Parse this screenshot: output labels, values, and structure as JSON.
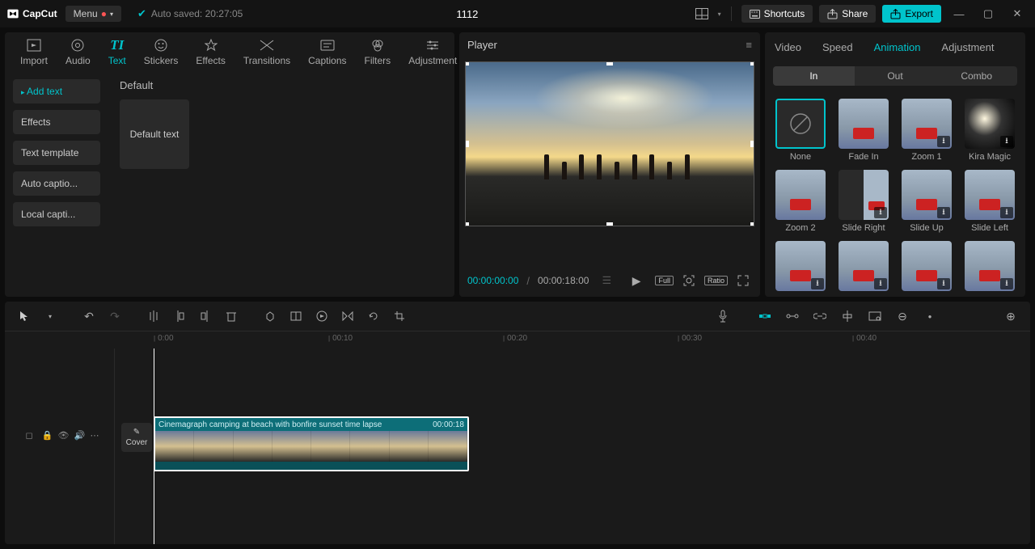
{
  "titlebar": {
    "app_name": "CapCut",
    "menu_label": "Menu",
    "auto_saved": "Auto saved: 20:27:05",
    "project_title": "1112",
    "shortcuts_label": "Shortcuts",
    "share_label": "Share",
    "export_label": "Export"
  },
  "media_tabs": [
    {
      "label": "Import"
    },
    {
      "label": "Audio"
    },
    {
      "label": "Text"
    },
    {
      "label": "Stickers"
    },
    {
      "label": "Effects"
    },
    {
      "label": "Transitions"
    },
    {
      "label": "Captions"
    },
    {
      "label": "Filters"
    },
    {
      "label": "Adjustment"
    }
  ],
  "text_sidebar": [
    {
      "label": "Add text"
    },
    {
      "label": "Effects"
    },
    {
      "label": "Text template"
    },
    {
      "label": "Auto captio..."
    },
    {
      "label": "Local capti..."
    }
  ],
  "text_content": {
    "heading": "Default",
    "preset_label": "Default text"
  },
  "player": {
    "title": "Player",
    "time_current": "00:00:00:00",
    "time_separator": "/",
    "time_total": "00:00:18:00",
    "full_label": "Full",
    "ratio_label": "Ratio"
  },
  "right_tabs": [
    {
      "label": "Video"
    },
    {
      "label": "Speed"
    },
    {
      "label": "Animation"
    },
    {
      "label": "Adjustment"
    }
  ],
  "anim_subtabs": [
    {
      "label": "In"
    },
    {
      "label": "Out"
    },
    {
      "label": "Combo"
    }
  ],
  "anim_items": [
    {
      "label": "None",
      "thumb": "none",
      "selected": true
    },
    {
      "label": "Fade In",
      "thumb": "img",
      "dl": false
    },
    {
      "label": "Zoom 1",
      "thumb": "img",
      "dl": true
    },
    {
      "label": "Kira Magic",
      "thumb": "kira",
      "dl": true
    },
    {
      "label": "Zoom 2",
      "thumb": "img",
      "dl": false
    },
    {
      "label": "Slide Right",
      "thumb": "dark",
      "dl": true
    },
    {
      "label": "Slide Up",
      "thumb": "img",
      "dl": true
    },
    {
      "label": "Slide Left",
      "thumb": "img",
      "dl": true
    },
    {
      "label": "",
      "thumb": "img",
      "dl": true
    },
    {
      "label": "",
      "thumb": "img",
      "dl": true
    },
    {
      "label": "",
      "thumb": "img",
      "dl": true
    },
    {
      "label": "",
      "thumb": "img",
      "dl": true
    }
  ],
  "timeline": {
    "ticks": [
      {
        "label": "0:00",
        "pos": 184
      },
      {
        "label": "00:10",
        "pos": 400
      },
      {
        "label": "00:20",
        "pos": 616
      },
      {
        "label": "00:30",
        "pos": 832
      },
      {
        "label": "00:40",
        "pos": 1048
      }
    ],
    "cover_label": "Cover",
    "clip_title": "Cinemagraph camping at beach with bonfire sunset time lapse",
    "clip_duration": "00:00:18"
  }
}
